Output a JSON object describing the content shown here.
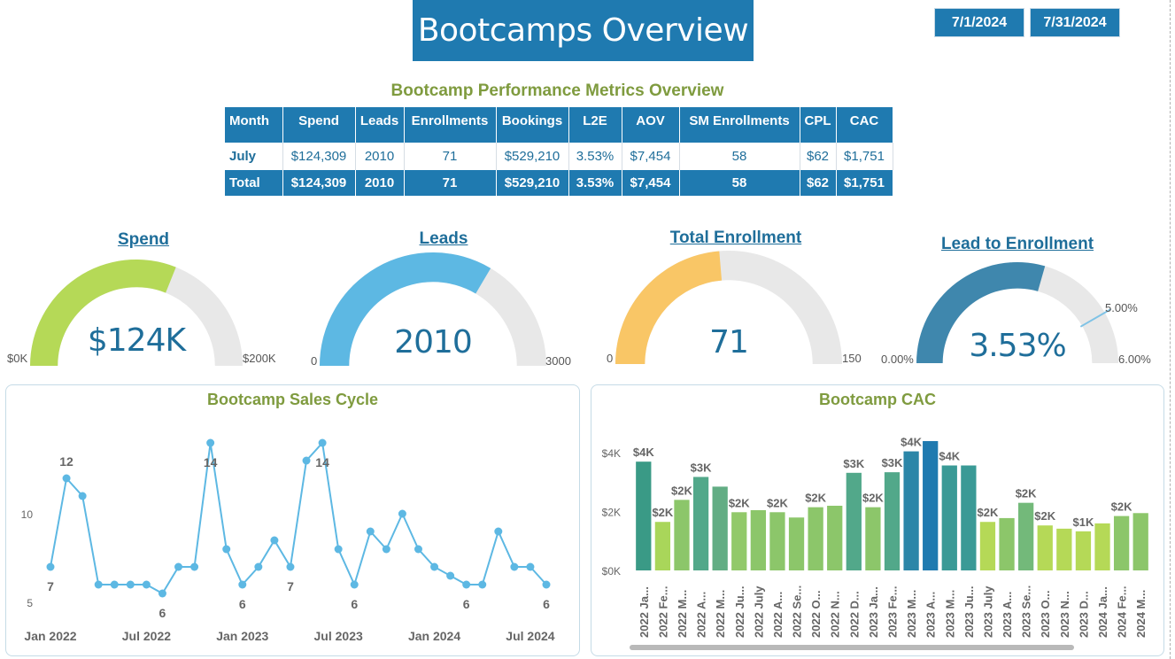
{
  "header": {
    "title": "Bootcamps Overview",
    "start_date": "7/1/2024",
    "end_date": "7/31/2024"
  },
  "metrics_table": {
    "title": "Bootcamp Performance Metrics Overview",
    "columns": [
      "Month",
      "Spend",
      "Leads",
      "Enrollments",
      "Bookings",
      "L2E",
      "AOV",
      "SM Enrollments",
      "CPL",
      "CAC"
    ],
    "rows": [
      [
        "July",
        "$124,309",
        "2010",
        "71",
        "$529,210",
        "3.53%",
        "$7,454",
        "58",
        "$62",
        "$1,751"
      ],
      [
        "Total",
        "$124,309",
        "2010",
        "71",
        "$529,210",
        "3.53%",
        "$7,454",
        "58",
        "$62",
        "$1,751"
      ]
    ]
  },
  "gauges": [
    {
      "title": "Spend",
      "value_label": "$124K",
      "min_label": "$0K",
      "max_label": "$200K",
      "value": 124309,
      "min": 0,
      "max": 200000,
      "color": "#b5d957"
    },
    {
      "title": "Leads",
      "value_label": "2010",
      "min_label": "0",
      "max_label": "3000",
      "value": 2010,
      "min": 0,
      "max": 3000,
      "color": "#5db8e3"
    },
    {
      "title": "Total Enrollment",
      "value_label": "71",
      "min_label": "0",
      "max_label": "150",
      "value": 71,
      "min": 0,
      "max": 150,
      "color": "#f9c666"
    },
    {
      "title": "Lead to Enrollment",
      "value_label": "3.53%",
      "min_label": "0.00%",
      "max_label": "6.00%",
      "target_label": "5.00%",
      "value": 3.53,
      "min": 0,
      "max": 6,
      "target": 5,
      "color": "#3f87ad"
    }
  ],
  "chart_data": [
    {
      "type": "line",
      "title": "Bootcamp Sales Cycle",
      "ylim": [
        4.6,
        14.8
      ],
      "yticks": [
        {
          "value": 5,
          "label": "5"
        },
        {
          "value": 10,
          "label": "10"
        }
      ],
      "xticks": [
        {
          "index": 0,
          "label": "Jan 2022"
        },
        {
          "index": 6,
          "label": "Jul 2022"
        },
        {
          "index": 12,
          "label": "Jan 2023"
        },
        {
          "index": 18,
          "label": "Jul 2023"
        },
        {
          "index": 24,
          "label": "Jan 2024"
        },
        {
          "index": 30,
          "label": "Jul 2024"
        }
      ],
      "values": [
        7,
        12,
        11,
        6,
        6,
        6,
        6,
        5.5,
        7,
        7,
        14,
        8,
        6,
        7,
        8.5,
        7,
        13,
        14,
        8,
        6,
        9,
        8,
        10,
        8,
        7,
        6.5,
        6,
        6,
        9,
        7,
        7,
        6
      ],
      "point_labels": [
        {
          "index": 0,
          "label": "7",
          "pos": "below"
        },
        {
          "index": 1,
          "label": "12",
          "pos": "above"
        },
        {
          "index": 7,
          "label": "6",
          "pos": "below"
        },
        {
          "index": 10,
          "label": "14",
          "pos": "below"
        },
        {
          "index": 12,
          "label": "6",
          "pos": "below"
        },
        {
          "index": 15,
          "label": "7",
          "pos": "below"
        },
        {
          "index": 17,
          "label": "14",
          "pos": "below"
        },
        {
          "index": 19,
          "label": "6",
          "pos": "below"
        },
        {
          "index": 26,
          "label": "6",
          "pos": "below"
        },
        {
          "index": 31,
          "label": "6",
          "pos": "below"
        }
      ],
      "line_color": "#5db8e3"
    },
    {
      "type": "bar",
      "title": "Bootcamp CAC",
      "ylim": [
        0,
        4700
      ],
      "yticks": [
        {
          "value": 0,
          "label": "$0K"
        },
        {
          "value": 2000,
          "label": "$2K"
        },
        {
          "value": 4000,
          "label": "$4K"
        }
      ],
      "categories": [
        "2022 Ja...",
        "2022 Fe...",
        "2022 M...",
        "2022 A...",
        "2022 M...",
        "2022 Ju...",
        "2022 July",
        "2022 A...",
        "2022 Se...",
        "2022 O...",
        "2022 N...",
        "2022 D...",
        "2023 Ja...",
        "2023 Fe...",
        "2023 M...",
        "2023 A...",
        "2023 M...",
        "2023 Ju...",
        "2023 July",
        "2023 A...",
        "2023 Se...",
        "2023 O...",
        "2023 N...",
        "2023 D...",
        "2024 Ja...",
        "2024 Fe...",
        "2024 M..."
      ],
      "values": [
        3700,
        1650,
        2400,
        3180,
        2850,
        1980,
        2050,
        1980,
        1800,
        2150,
        2200,
        3320,
        2150,
        3340,
        4050,
        4400,
        3570,
        3570,
        1650,
        1780,
        2300,
        1530,
        1420,
        1330,
        1600,
        1850,
        1950
      ],
      "data_labels": [
        "$4K",
        "$2K",
        "$2K",
        "$3K",
        "",
        "$2K",
        "",
        "$2K",
        "",
        "$2K",
        "",
        "$3K",
        "$2K",
        "$3K",
        "$4K",
        "",
        "$4K",
        "",
        "$2K",
        "",
        "$2K",
        "$2K",
        "",
        "$1K",
        "",
        "$2K",
        ""
      ],
      "bar_colors": [
        "#3a9a86",
        "#a9d65a",
        "#8cc66a",
        "#52a88a",
        "#62ad84",
        "#92c96a",
        "#8cc66a",
        "#8cc66a",
        "#8cc66a",
        "#8cc66a",
        "#8cc66a",
        "#52a88a",
        "#8cc66a",
        "#52a88a",
        "#2b86a8",
        "#1f7ab0",
        "#3a9a96",
        "#3a9a96",
        "#b5d957",
        "#8cc66a",
        "#73b97a",
        "#b5d957",
        "#b5d957",
        "#b5d957",
        "#b5d957",
        "#8cc66a",
        "#8cc66a"
      ]
    }
  ]
}
